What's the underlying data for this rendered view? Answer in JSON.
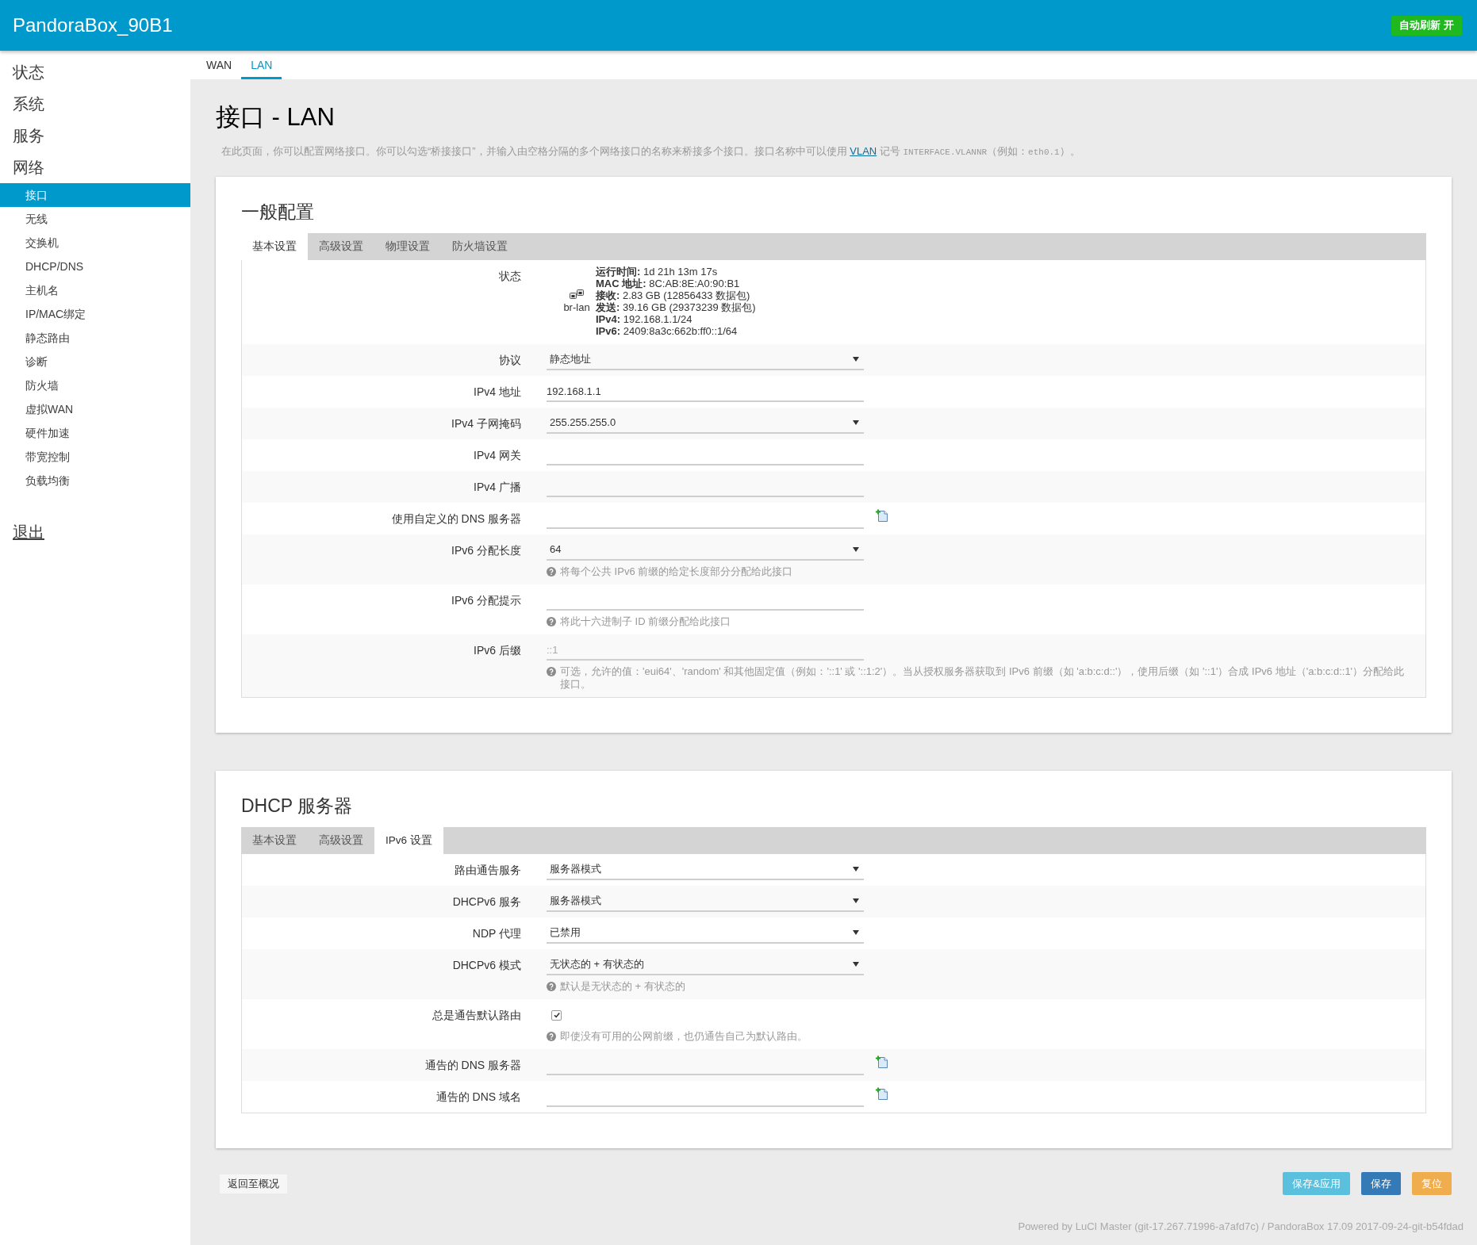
{
  "header": {
    "title": "PandoraBox_90B1",
    "auto_refresh_button": "自动刷新 开"
  },
  "sidebar": {
    "menu": [
      {
        "label": "状态"
      },
      {
        "label": "系统"
      },
      {
        "label": "服务"
      },
      {
        "label": "网络",
        "children": [
          {
            "label": "接口",
            "selected": true
          },
          {
            "label": "无线",
            "selected": false
          },
          {
            "label": "交换机",
            "selected": false
          },
          {
            "label": "DHCP/DNS",
            "selected": false
          },
          {
            "label": "主机名",
            "selected": false
          },
          {
            "label": "IP/MAC绑定",
            "selected": false
          },
          {
            "label": "静态路由",
            "selected": false
          },
          {
            "label": "诊断",
            "selected": false
          },
          {
            "label": "防火墙",
            "selected": false
          },
          {
            "label": "虚拟WAN",
            "selected": false
          },
          {
            "label": "硬件加速",
            "selected": false
          },
          {
            "label": "带宽控制",
            "selected": false
          },
          {
            "label": "负载均衡",
            "selected": false
          }
        ]
      }
    ],
    "logout": "退出"
  },
  "interface_tabs": [
    {
      "label": "WAN",
      "selected": false
    },
    {
      "label": "LAN",
      "selected": true
    }
  ],
  "page": {
    "title": "接口 - LAN",
    "description": [
      {
        "kind": "text",
        "text": "在此页面，你可以配置网络接口。你可以勾选“桥接接口”，并输入由空格分隔的多个网络接口的名称来桥接多个接口。接口名称中可以使用 "
      },
      {
        "kind": "link",
        "text": "VLAN"
      },
      {
        "kind": "text",
        "text": " 记号 "
      },
      {
        "kind": "code",
        "text": "INTERFACE.VLANNR"
      },
      {
        "kind": "text",
        "text": "（例如："
      },
      {
        "kind": "code",
        "text": "eth0.1"
      },
      {
        "kind": "text",
        "text": "）。"
      }
    ]
  },
  "sections": [
    {
      "title": "一般配置",
      "tabs": [
        {
          "label": "基本设置",
          "selected": true
        },
        {
          "label": "高级设置",
          "selected": false
        },
        {
          "label": "物理设置",
          "selected": false
        },
        {
          "label": "防火墙设置",
          "selected": false
        }
      ],
      "rows": [
        {
          "kind": "status",
          "label": "状态",
          "device": "br-lan",
          "lines": [
            "**运行时间:** 1d 21h 13m 17s",
            "**MAC 地址:** 8C:AB:8E:A0:90:B1",
            "**接收:** 2.83 GB (12856433 数据包)",
            "**发送:** 39.16 GB (29373239 数据包)",
            "**IPv4:** 192.168.1.1/24",
            "**IPv6:** 2409:8a3c:662b:ff0::1/64"
          ]
        },
        {
          "kind": "select",
          "label": "协议",
          "value": "静态地址"
        },
        {
          "kind": "text",
          "label": "IPv4 地址",
          "value": "192.168.1.1"
        },
        {
          "kind": "select",
          "label": "IPv4 子网掩码",
          "value": "255.255.255.0"
        },
        {
          "kind": "text",
          "label": "IPv4 网关"
        },
        {
          "kind": "text",
          "label": "IPv4 广播"
        },
        {
          "kind": "list",
          "label": "使用自定义的 DNS 服务器"
        },
        {
          "kind": "select",
          "label": "IPv6 分配长度",
          "value": "64",
          "help": "将每个公共 IPv6 前缀的给定长度部分分配给此接口"
        },
        {
          "kind": "text",
          "label": "IPv6 分配提示",
          "help": "将此十六进制子 ID 前缀分配给此接口"
        },
        {
          "kind": "text",
          "label": "IPv6 后缀",
          "placeholder": "::1",
          "help": "可选，允许的值：'eui64'、'random' 和其他固定值（例如：'::1' 或 '::1:2'）。当从授权服务器获取到 IPv6 前缀（如 'a:b:c:d::'），使用后缀（如 '::1'）合成 IPv6 地址（'a:b:c:d::1'）分配给此接口。"
        }
      ]
    },
    {
      "title": "DHCP 服务器",
      "tabs": [
        {
          "label": "基本设置",
          "selected": false
        },
        {
          "label": "高级设置",
          "selected": false
        },
        {
          "label": "IPv6 设置",
          "selected": true
        }
      ],
      "rows": [
        {
          "kind": "select",
          "label": "路由通告服务",
          "value": "服务器模式"
        },
        {
          "kind": "select",
          "label": "DHCPv6 服务",
          "value": "服务器模式"
        },
        {
          "kind": "select",
          "label": "NDP 代理",
          "value": "已禁用"
        },
        {
          "kind": "select",
          "label": "DHCPv6 模式",
          "value": "无状态的 + 有状态的",
          "help": "默认是无状态的 + 有状态的"
        },
        {
          "kind": "checkbox",
          "label": "总是通告默认路由",
          "checked": true,
          "help": "即使没有可用的公网前缀，也仍通告自己为默认路由。"
        },
        {
          "kind": "list",
          "label": "通告的 DNS 服务器"
        },
        {
          "kind": "list",
          "label": "通告的 DNS 域名"
        }
      ]
    }
  ],
  "footer": {
    "back_button": "返回至概况",
    "buttons": [
      {
        "label": "保存&应用",
        "kind": "apply"
      },
      {
        "label": "保存",
        "kind": "save"
      },
      {
        "label": "复位",
        "kind": "reset"
      }
    ],
    "powered_by": "Powered by LuCI Master (git-17.267.71996-a7afd7c) / PandoraBox 17.09 2017-09-24-git-b54fdad"
  }
}
